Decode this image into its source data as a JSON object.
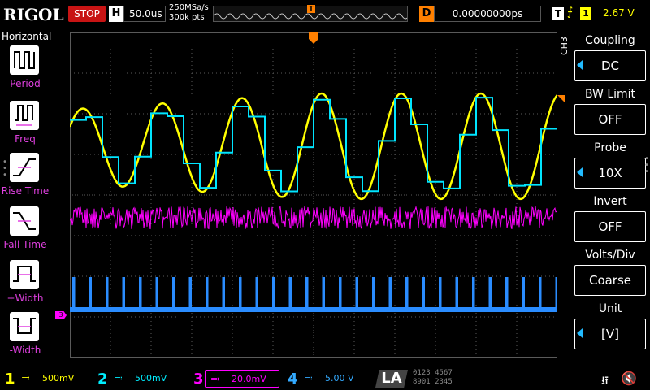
{
  "topbar": {
    "logo": "RIGOL",
    "run_state": "STOP",
    "h_label": "H",
    "timebase": "50.0us",
    "sample_rate": "250MSa/s",
    "memory_depth": "300k pts",
    "trigger_marker": "T",
    "delay_label": "D",
    "delay_value": "0.00000000ps",
    "trigger_label": "T",
    "trigger_source": "1",
    "trigger_level": "2.67 V"
  },
  "left_panel": {
    "title": "Horizontal",
    "items": [
      {
        "label": "Period",
        "icon": "period-icon"
      },
      {
        "label": "Freq",
        "icon": "freq-icon"
      },
      {
        "label": "Rise Time",
        "icon": "rise-time-icon"
      },
      {
        "label": "Fall Time",
        "icon": "fall-time-icon"
      },
      {
        "label": "+Width",
        "icon": "positive-width-icon"
      },
      {
        "label": "-Width",
        "icon": "negative-width-icon"
      }
    ]
  },
  "right_menu": {
    "channel": "CH3",
    "items": [
      {
        "title": "Coupling",
        "value": "DC",
        "has_arrow": true
      },
      {
        "title": "BW Limit",
        "value": "OFF",
        "has_arrow": false
      },
      {
        "title": "Probe",
        "value": "10X",
        "has_arrow": true
      },
      {
        "title": "Invert",
        "value": "OFF",
        "has_arrow": false
      },
      {
        "title": "Volts/Div",
        "value": "Coarse",
        "has_arrow": false
      },
      {
        "title": "Unit",
        "value": "[V]",
        "has_arrow": true
      }
    ]
  },
  "channels": [
    {
      "num": "1",
      "scale": "500mV",
      "color": "#ffff00"
    },
    {
      "num": "2",
      "scale": "500mV",
      "color": "#00e5ff"
    },
    {
      "num": "3",
      "scale": "20.0mV",
      "color": "#ff00ff"
    },
    {
      "num": "4",
      "scale": "5.00 V",
      "color": "#2a8cff"
    }
  ],
  "la": {
    "label": "LA",
    "row1": "0123 4567",
    "row2": "8901 2345"
  },
  "ch3_marker": "3",
  "colors": {
    "grid": "#5a5a5a",
    "trigger": "#ff8000",
    "stop_bg": "#c81414"
  }
}
